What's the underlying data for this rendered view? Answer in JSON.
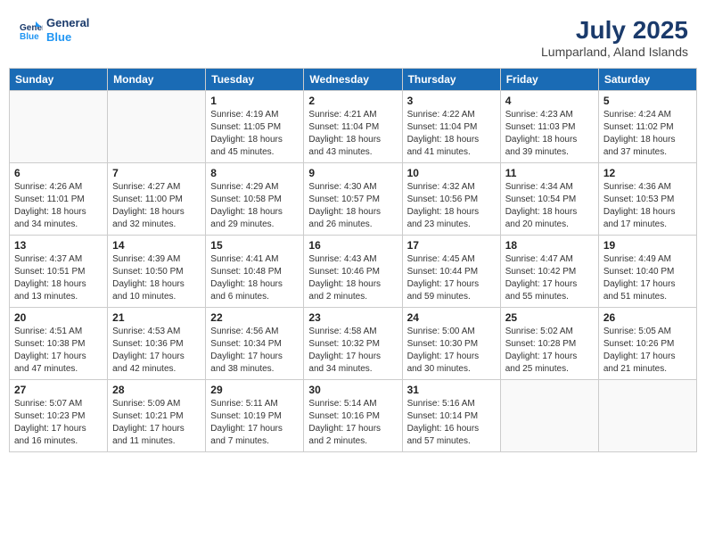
{
  "logo": {
    "line1": "General",
    "line2": "Blue"
  },
  "title": "July 2025",
  "location": "Lumparland, Aland Islands",
  "weekdays": [
    "Sunday",
    "Monday",
    "Tuesday",
    "Wednesday",
    "Thursday",
    "Friday",
    "Saturday"
  ],
  "weeks": [
    [
      {
        "day": null
      },
      {
        "day": null
      },
      {
        "day": "1",
        "sunrise": "4:19 AM",
        "sunset": "11:05 PM",
        "daylight": "18 hours and 45 minutes."
      },
      {
        "day": "2",
        "sunrise": "4:21 AM",
        "sunset": "11:04 PM",
        "daylight": "18 hours and 43 minutes."
      },
      {
        "day": "3",
        "sunrise": "4:22 AM",
        "sunset": "11:04 PM",
        "daylight": "18 hours and 41 minutes."
      },
      {
        "day": "4",
        "sunrise": "4:23 AM",
        "sunset": "11:03 PM",
        "daylight": "18 hours and 39 minutes."
      },
      {
        "day": "5",
        "sunrise": "4:24 AM",
        "sunset": "11:02 PM",
        "daylight": "18 hours and 37 minutes."
      }
    ],
    [
      {
        "day": "6",
        "sunrise": "4:26 AM",
        "sunset": "11:01 PM",
        "daylight": "18 hours and 34 minutes."
      },
      {
        "day": "7",
        "sunrise": "4:27 AM",
        "sunset": "11:00 PM",
        "daylight": "18 hours and 32 minutes."
      },
      {
        "day": "8",
        "sunrise": "4:29 AM",
        "sunset": "10:58 PM",
        "daylight": "18 hours and 29 minutes."
      },
      {
        "day": "9",
        "sunrise": "4:30 AM",
        "sunset": "10:57 PM",
        "daylight": "18 hours and 26 minutes."
      },
      {
        "day": "10",
        "sunrise": "4:32 AM",
        "sunset": "10:56 PM",
        "daylight": "18 hours and 23 minutes."
      },
      {
        "day": "11",
        "sunrise": "4:34 AM",
        "sunset": "10:54 PM",
        "daylight": "18 hours and 20 minutes."
      },
      {
        "day": "12",
        "sunrise": "4:36 AM",
        "sunset": "10:53 PM",
        "daylight": "18 hours and 17 minutes."
      }
    ],
    [
      {
        "day": "13",
        "sunrise": "4:37 AM",
        "sunset": "10:51 PM",
        "daylight": "18 hours and 13 minutes."
      },
      {
        "day": "14",
        "sunrise": "4:39 AM",
        "sunset": "10:50 PM",
        "daylight": "18 hours and 10 minutes."
      },
      {
        "day": "15",
        "sunrise": "4:41 AM",
        "sunset": "10:48 PM",
        "daylight": "18 hours and 6 minutes."
      },
      {
        "day": "16",
        "sunrise": "4:43 AM",
        "sunset": "10:46 PM",
        "daylight": "18 hours and 2 minutes."
      },
      {
        "day": "17",
        "sunrise": "4:45 AM",
        "sunset": "10:44 PM",
        "daylight": "17 hours and 59 minutes."
      },
      {
        "day": "18",
        "sunrise": "4:47 AM",
        "sunset": "10:42 PM",
        "daylight": "17 hours and 55 minutes."
      },
      {
        "day": "19",
        "sunrise": "4:49 AM",
        "sunset": "10:40 PM",
        "daylight": "17 hours and 51 minutes."
      }
    ],
    [
      {
        "day": "20",
        "sunrise": "4:51 AM",
        "sunset": "10:38 PM",
        "daylight": "17 hours and 47 minutes."
      },
      {
        "day": "21",
        "sunrise": "4:53 AM",
        "sunset": "10:36 PM",
        "daylight": "17 hours and 42 minutes."
      },
      {
        "day": "22",
        "sunrise": "4:56 AM",
        "sunset": "10:34 PM",
        "daylight": "17 hours and 38 minutes."
      },
      {
        "day": "23",
        "sunrise": "4:58 AM",
        "sunset": "10:32 PM",
        "daylight": "17 hours and 34 minutes."
      },
      {
        "day": "24",
        "sunrise": "5:00 AM",
        "sunset": "10:30 PM",
        "daylight": "17 hours and 30 minutes."
      },
      {
        "day": "25",
        "sunrise": "5:02 AM",
        "sunset": "10:28 PM",
        "daylight": "17 hours and 25 minutes."
      },
      {
        "day": "26",
        "sunrise": "5:05 AM",
        "sunset": "10:26 PM",
        "daylight": "17 hours and 21 minutes."
      }
    ],
    [
      {
        "day": "27",
        "sunrise": "5:07 AM",
        "sunset": "10:23 PM",
        "daylight": "17 hours and 16 minutes."
      },
      {
        "day": "28",
        "sunrise": "5:09 AM",
        "sunset": "10:21 PM",
        "daylight": "17 hours and 11 minutes."
      },
      {
        "day": "29",
        "sunrise": "5:11 AM",
        "sunset": "10:19 PM",
        "daylight": "17 hours and 7 minutes."
      },
      {
        "day": "30",
        "sunrise": "5:14 AM",
        "sunset": "10:16 PM",
        "daylight": "17 hours and 2 minutes."
      },
      {
        "day": "31",
        "sunrise": "5:16 AM",
        "sunset": "10:14 PM",
        "daylight": "16 hours and 57 minutes."
      },
      {
        "day": null
      },
      {
        "day": null
      }
    ]
  ]
}
